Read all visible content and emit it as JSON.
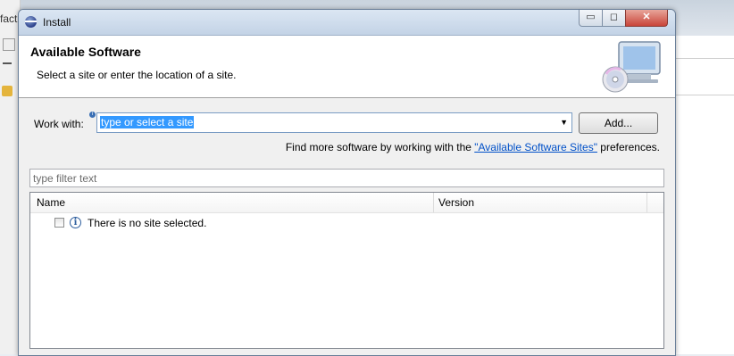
{
  "background": {
    "left_text": "fact"
  },
  "window": {
    "title": "Install",
    "minimize_glyph": "▭",
    "maximize_glyph": "◻",
    "close_glyph": "✕"
  },
  "header": {
    "title": "Available Software",
    "description": "Select a site or enter the location of a site."
  },
  "work_with": {
    "label": "Work with:",
    "info_glyph": "i",
    "value": "type or select a site",
    "dropdown_glyph": "▼",
    "add_button": "Add..."
  },
  "find_more": {
    "prefix": "Find more software by working with the ",
    "link": "\"Available Software Sites\"",
    "suffix": " preferences."
  },
  "filter": {
    "placeholder": "type filter text"
  },
  "table": {
    "columns": [
      "Name",
      "Version"
    ],
    "rows": [
      {
        "checked": false,
        "icon": "info-icon",
        "info_glyph": "i",
        "name": "There is no site selected."
      }
    ]
  },
  "colors": {
    "selection": "#3399ff",
    "link": "#0050c8",
    "titlebar": "#c3d3e6"
  }
}
